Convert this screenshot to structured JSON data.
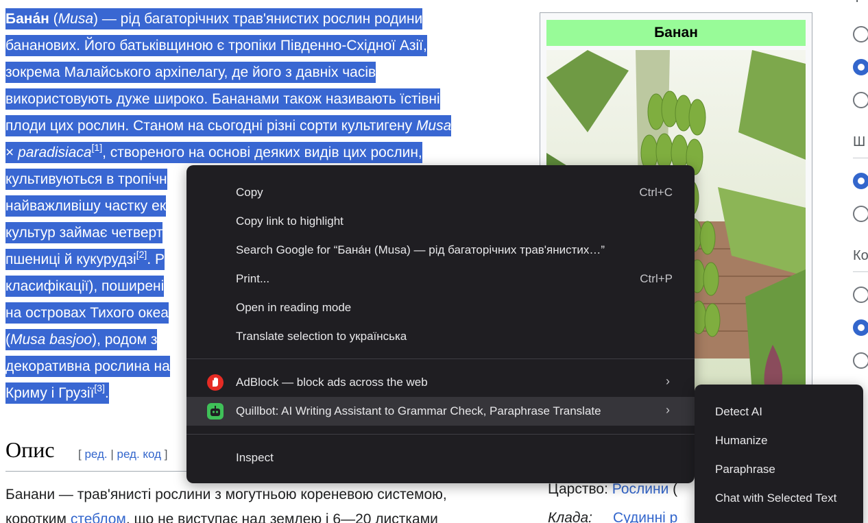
{
  "article": {
    "lines": [
      [
        {
          "t": "Бана́н",
          "s": "b"
        },
        {
          "t": " ("
        },
        {
          "t": "Musa",
          "s": "i"
        },
        {
          "t": ") — рід багаторічних трав'янистих рослин родини"
        }
      ],
      [
        {
          "t": "бананових. Його батьківщиною є тропіки Південно-Східної Азії,"
        }
      ],
      [
        {
          "t": "зокрема Малайського архіпелагу, де його з давніх часів"
        }
      ],
      [
        {
          "t": "використовують дуже широко. Бананами також називають їстівні"
        }
      ],
      [
        {
          "t": "плоди цих рослин. Станом на сьогодні різні сорти культигену "
        },
        {
          "t": "Musa",
          "s": "i"
        }
      ],
      [
        {
          "t": "× "
        },
        {
          "t": "paradisiaca",
          "s": "i"
        },
        {
          "t": "[1]",
          "s": "sup"
        },
        {
          "t": ", створеного на основі деяких видів цих рослин,"
        }
      ],
      [
        {
          "t": "культивуються в тропічн"
        }
      ],
      [
        {
          "t": "найважливішу частку ек"
        }
      ],
      [
        {
          "t": "культур займає четверт"
        }
      ],
      [
        {
          "t": "пшениці й кукурудзі"
        },
        {
          "t": "[2]",
          "s": "sup"
        },
        {
          "t": ". Р"
        }
      ],
      [
        {
          "t": "класифікації), поширені"
        }
      ],
      [
        {
          "t": "на островах Тихого океа"
        }
      ],
      [
        {
          "t": "("
        },
        {
          "t": "Musa basjoo",
          "s": "i"
        },
        {
          "t": "), родом з"
        }
      ],
      [
        {
          "t": "декоративна рослина на"
        }
      ],
      [
        {
          "t": "Криму і Грузії"
        },
        {
          "t": "[3]",
          "s": "sup"
        },
        {
          "t": "."
        }
      ]
    ]
  },
  "section": {
    "title": "Опис",
    "edit_open": "[ ",
    "edit": "ред.",
    "edit_sep": " | ",
    "edit_code": "ред. код",
    "edit_close": " ]"
  },
  "para2": {
    "line1": "Банани — трав'янисті рослини з могутньою кореневою системою,",
    "line2_before": "коротким ",
    "line2_link": "стеблом",
    "line2_after": ", що не виступає над землею і 6—20 листками"
  },
  "infobox": {
    "title": "Банан",
    "kingdom_label": "Царство:",
    "kingdom_value": "Рослини",
    "kingdom_rest": " (",
    "clade_label": "Клада:",
    "clade_value": "Судинні р"
  },
  "panel": {
    "label_1": "Ш",
    "label_2": "Ко",
    "label_0": "Т"
  },
  "context_menu": {
    "items": [
      {
        "label": "Copy",
        "shortcut": "Ctrl+C"
      },
      {
        "label": "Copy link to highlight",
        "shortcut": ""
      },
      {
        "label": "Search Google for “Бана́н (Musa) — рід багаторічних трав'янистих…”",
        "shortcut": ""
      },
      {
        "label": "Print...",
        "shortcut": "Ctrl+P"
      },
      {
        "label": "Open in reading mode",
        "shortcut": ""
      },
      {
        "label": "Translate selection to українська",
        "shortcut": ""
      }
    ],
    "extensions": [
      {
        "label": "AdBlock — block ads across the web",
        "icon": "adblock-hand-icon"
      },
      {
        "label": "Quillbot: AI Writing Assistant to Grammar Check, Paraphrase  Translate",
        "icon": "quillbot-robot-icon"
      }
    ],
    "inspect": "Inspect",
    "submenu_arrow": "›"
  },
  "submenu": {
    "items": [
      "Detect AI",
      "Humanize",
      "Paraphrase",
      "Chat with Selected Text"
    ]
  },
  "colors": {
    "selection": "#3967d2",
    "menu_bg": "#1f1e22",
    "infobox_title": "#98fb98",
    "link": "#3366cc"
  }
}
